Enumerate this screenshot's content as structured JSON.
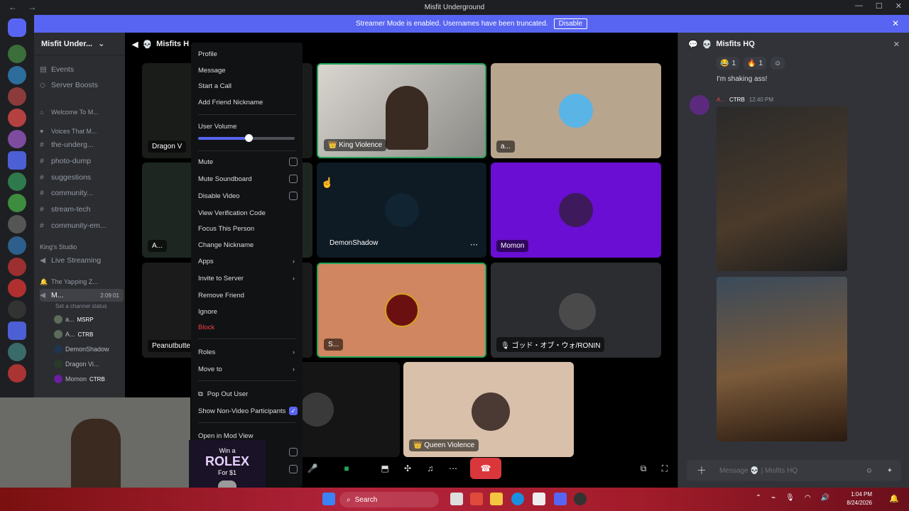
{
  "window": {
    "title": "Misfit Underground"
  },
  "banner": {
    "text": "Streamer Mode is enabled. Usernames have been truncated.",
    "button": "Disable"
  },
  "sidebar": {
    "server_name": "Misfit Under...",
    "items": [
      "Events",
      "Server Boosts"
    ],
    "categories": [
      "Welcome To M...",
      "Voices That M...",
      "King's Studio",
      "The Yapping Z..."
    ],
    "channels": [
      "the-underg...",
      "photo-dump",
      "suggestions",
      "community...",
      "stream-tech",
      "community-em..."
    ],
    "live": "Live Streaming",
    "active_voice": {
      "name": "M...",
      "timer": "2:09:01",
      "status_prompt": "Set a channel status"
    },
    "voice_users": [
      {
        "name": "a...",
        "tag": "MSRP"
      },
      {
        "name": "A...",
        "tag": "CTRB"
      },
      {
        "name": "DemonShadow",
        "tag": ""
      },
      {
        "name": "Dragon Vi...",
        "tag": ""
      },
      {
        "name": "Momon",
        "tag": "CTRB"
      }
    ]
  },
  "main": {
    "channel_title": "Misfits H",
    "tiles": {
      "dragon": "Dragon V",
      "left_a": "A...",
      "peanut": "Peanutbutte",
      "king": "King Violence",
      "a_top": "a...",
      "demon": "DemonShadow",
      "momon": "Momon",
      "soup": "S...",
      "ronin": "ゴッド・オブ・ウォ/RONIN",
      "queen": "Queen Violence"
    }
  },
  "context_menu": {
    "top": [
      "Profile",
      "Message",
      "Start a Call",
      "Add Friend Nickname"
    ],
    "volume_label": "User Volume",
    "volume_value": 0.52,
    "toggles": [
      "Mute",
      "Mute Soundboard",
      "Disable Video"
    ],
    "actions": [
      "View Verification Code",
      "Focus This Person",
      "Change Nickname"
    ],
    "submenus": [
      "Apps",
      "Invite to Server"
    ],
    "more": [
      "Remove Friend",
      "Ignore"
    ],
    "danger": "Block",
    "submenus2": [
      "Roles",
      "Move to"
    ],
    "pop_out": "Pop Out User",
    "show_nonvideo": "Show Non-Video Participants",
    "mod_view": "Open in Mod View"
  },
  "right_panel": {
    "title": "Misfits HQ",
    "reactions": [
      {
        "emoji": "😂",
        "count": "1"
      },
      {
        "emoji": "🔥",
        "count": "1"
      }
    ],
    "message_text": "I'm shaking ass!",
    "author": "A...",
    "author_tag": "CTRB",
    "time": "12:40 PM",
    "input_placeholder": "Message 💀 | Misfits HQ"
  },
  "ad": {
    "line1": "Win a",
    "line2": "ROLEX",
    "line3": "For $1"
  },
  "taskbar": {
    "search": "Search",
    "time": "1:04 PM",
    "date": "8/24/2026"
  },
  "colors": {
    "accent": "#5865f2",
    "danger": "#f23f43",
    "taskbar": "#b4233c"
  }
}
